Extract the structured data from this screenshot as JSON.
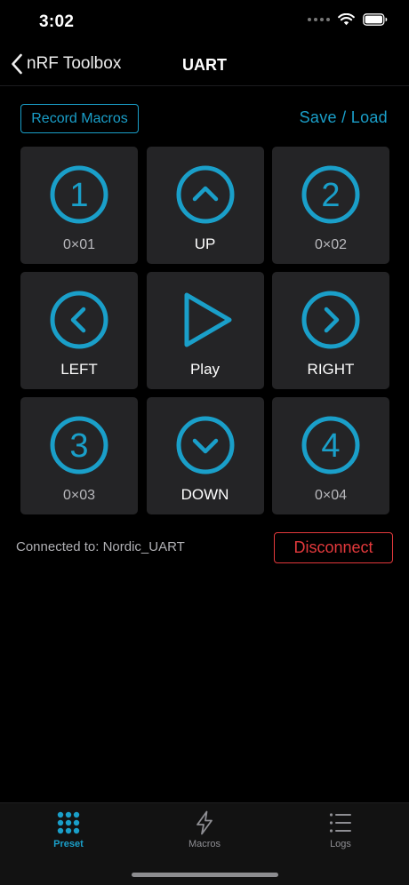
{
  "status_bar": {
    "time": "3:02"
  },
  "nav": {
    "back_label": "nRF Toolbox",
    "title": "UART"
  },
  "toolbar": {
    "record_label": "Record Macros",
    "save_load_label": "Save / Load"
  },
  "colors": {
    "accent": "#1a9fc9",
    "danger": "#e3393c",
    "cell_bg": "#242426"
  },
  "grid": {
    "cells": [
      {
        "icon": "number-1-circle-icon",
        "glyph": "1",
        "label": "0×01"
      },
      {
        "icon": "chevron-up-circle-icon",
        "glyph": "",
        "label": "UP"
      },
      {
        "icon": "number-2-circle-icon",
        "glyph": "2",
        "label": "0×02"
      },
      {
        "icon": "chevron-left-circle-icon",
        "glyph": "",
        "label": "LEFT"
      },
      {
        "icon": "play-icon",
        "glyph": "",
        "label": "Play"
      },
      {
        "icon": "chevron-right-circle-icon",
        "glyph": "",
        "label": "RIGHT"
      },
      {
        "icon": "number-3-circle-icon",
        "glyph": "3",
        "label": "0×03"
      },
      {
        "icon": "chevron-down-circle-icon",
        "glyph": "",
        "label": "DOWN"
      },
      {
        "icon": "number-4-circle-icon",
        "glyph": "4",
        "label": "0×04"
      }
    ]
  },
  "connection": {
    "status_text": "Connected to: Nordic_UART",
    "disconnect_label": "Disconnect"
  },
  "tabs": [
    {
      "label": "Preset",
      "icon": "grid-dots-icon",
      "active": true
    },
    {
      "label": "Macros",
      "icon": "lightning-icon",
      "active": false
    },
    {
      "label": "Logs",
      "icon": "list-icon",
      "active": false
    }
  ]
}
